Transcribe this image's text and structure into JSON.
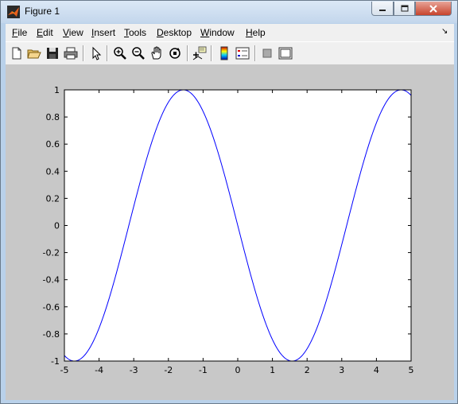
{
  "window": {
    "title": "Figure 1"
  },
  "menu": [
    {
      "key": "F",
      "rest": "ile"
    },
    {
      "key": "E",
      "rest": "dit"
    },
    {
      "key": "V",
      "rest": "iew"
    },
    {
      "key": "I",
      "rest": "nsert"
    },
    {
      "key": "T",
      "rest": "ools"
    },
    {
      "key": "D",
      "rest": "esktop"
    },
    {
      "key": "W",
      "rest": "indow"
    },
    {
      "key": "H",
      "rest": "elp"
    }
  ],
  "toolbar": {
    "items": [
      {
        "name": "new-figure-icon"
      },
      {
        "name": "open-file-icon"
      },
      {
        "name": "save-icon"
      },
      {
        "name": "print-icon"
      },
      {
        "name": "edit-plot-arrow-icon"
      },
      {
        "name": "zoom-in-icon"
      },
      {
        "name": "zoom-out-icon"
      },
      {
        "name": "pan-hand-icon"
      },
      {
        "name": "rotate-3d-icon"
      },
      {
        "name": "data-cursor-icon"
      },
      {
        "name": "colorbar-icon"
      },
      {
        "name": "legend-icon"
      },
      {
        "name": "hide-plot-tools-icon"
      },
      {
        "name": "show-plot-tools-icon"
      }
    ]
  },
  "chart_data": {
    "type": "line",
    "function": "sin(x + pi)",
    "xlim": [
      -5,
      5
    ],
    "ylim": [
      -1,
      1
    ],
    "xticks": [
      "-5",
      "-4",
      "-3",
      "-2",
      "-1",
      "0",
      "1",
      "2",
      "3",
      "4",
      "5"
    ],
    "yticks": [
      "1",
      "0.8",
      "0.6",
      "0.4",
      "0.2",
      "0",
      "-0.2",
      "-0.4",
      "-0.6",
      "-0.8",
      "-1"
    ],
    "series": [
      {
        "color": "#0000ff"
      }
    ],
    "grid": false
  }
}
